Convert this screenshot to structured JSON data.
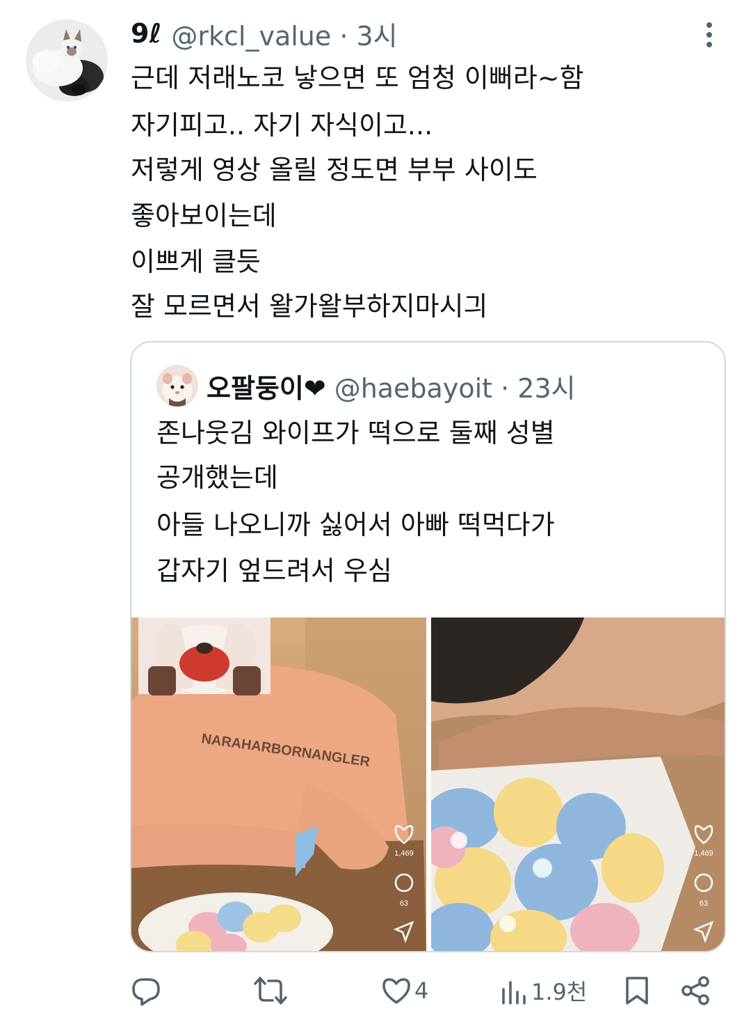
{
  "tweet": {
    "author_name": "9ℓ",
    "author_handle": "@rkcl_value · 3시",
    "avatar_icon": "cat-avatar-icon",
    "lines": [
      "근데 저래노코 낳으면 또 엄청 이뻐라~함",
      "자기피고.. 자기 자식이고...",
      "저렇게 영상 올릴 정도면 부부 사이도",
      "좋아보이는데",
      "이쁘게 클듯",
      "잘 모르면서 왈가왈부하지마시긔"
    ]
  },
  "quote": {
    "author_name": "오팔둥이❤",
    "author_handle": "@haebayoit · 23시",
    "lines": [
      "존나웃김 와이프가 떡으로 둘째 성별",
      "공개했는데",
      "아들 나오니까 싫어서 아빠 떡먹다가",
      "갑자기 엎드려서 우심"
    ],
    "media": [
      {
        "like_count": "1,469",
        "comment_count": "63"
      },
      {
        "like_count": "1,469",
        "comment_count": "63"
      }
    ]
  },
  "actions": {
    "reply_count": "",
    "retweet_count": "",
    "like_count": "4",
    "view_count": "1.9천"
  },
  "colors": {
    "text": "#0f1419",
    "secondary": "#536471",
    "border": "#cfd9de"
  }
}
